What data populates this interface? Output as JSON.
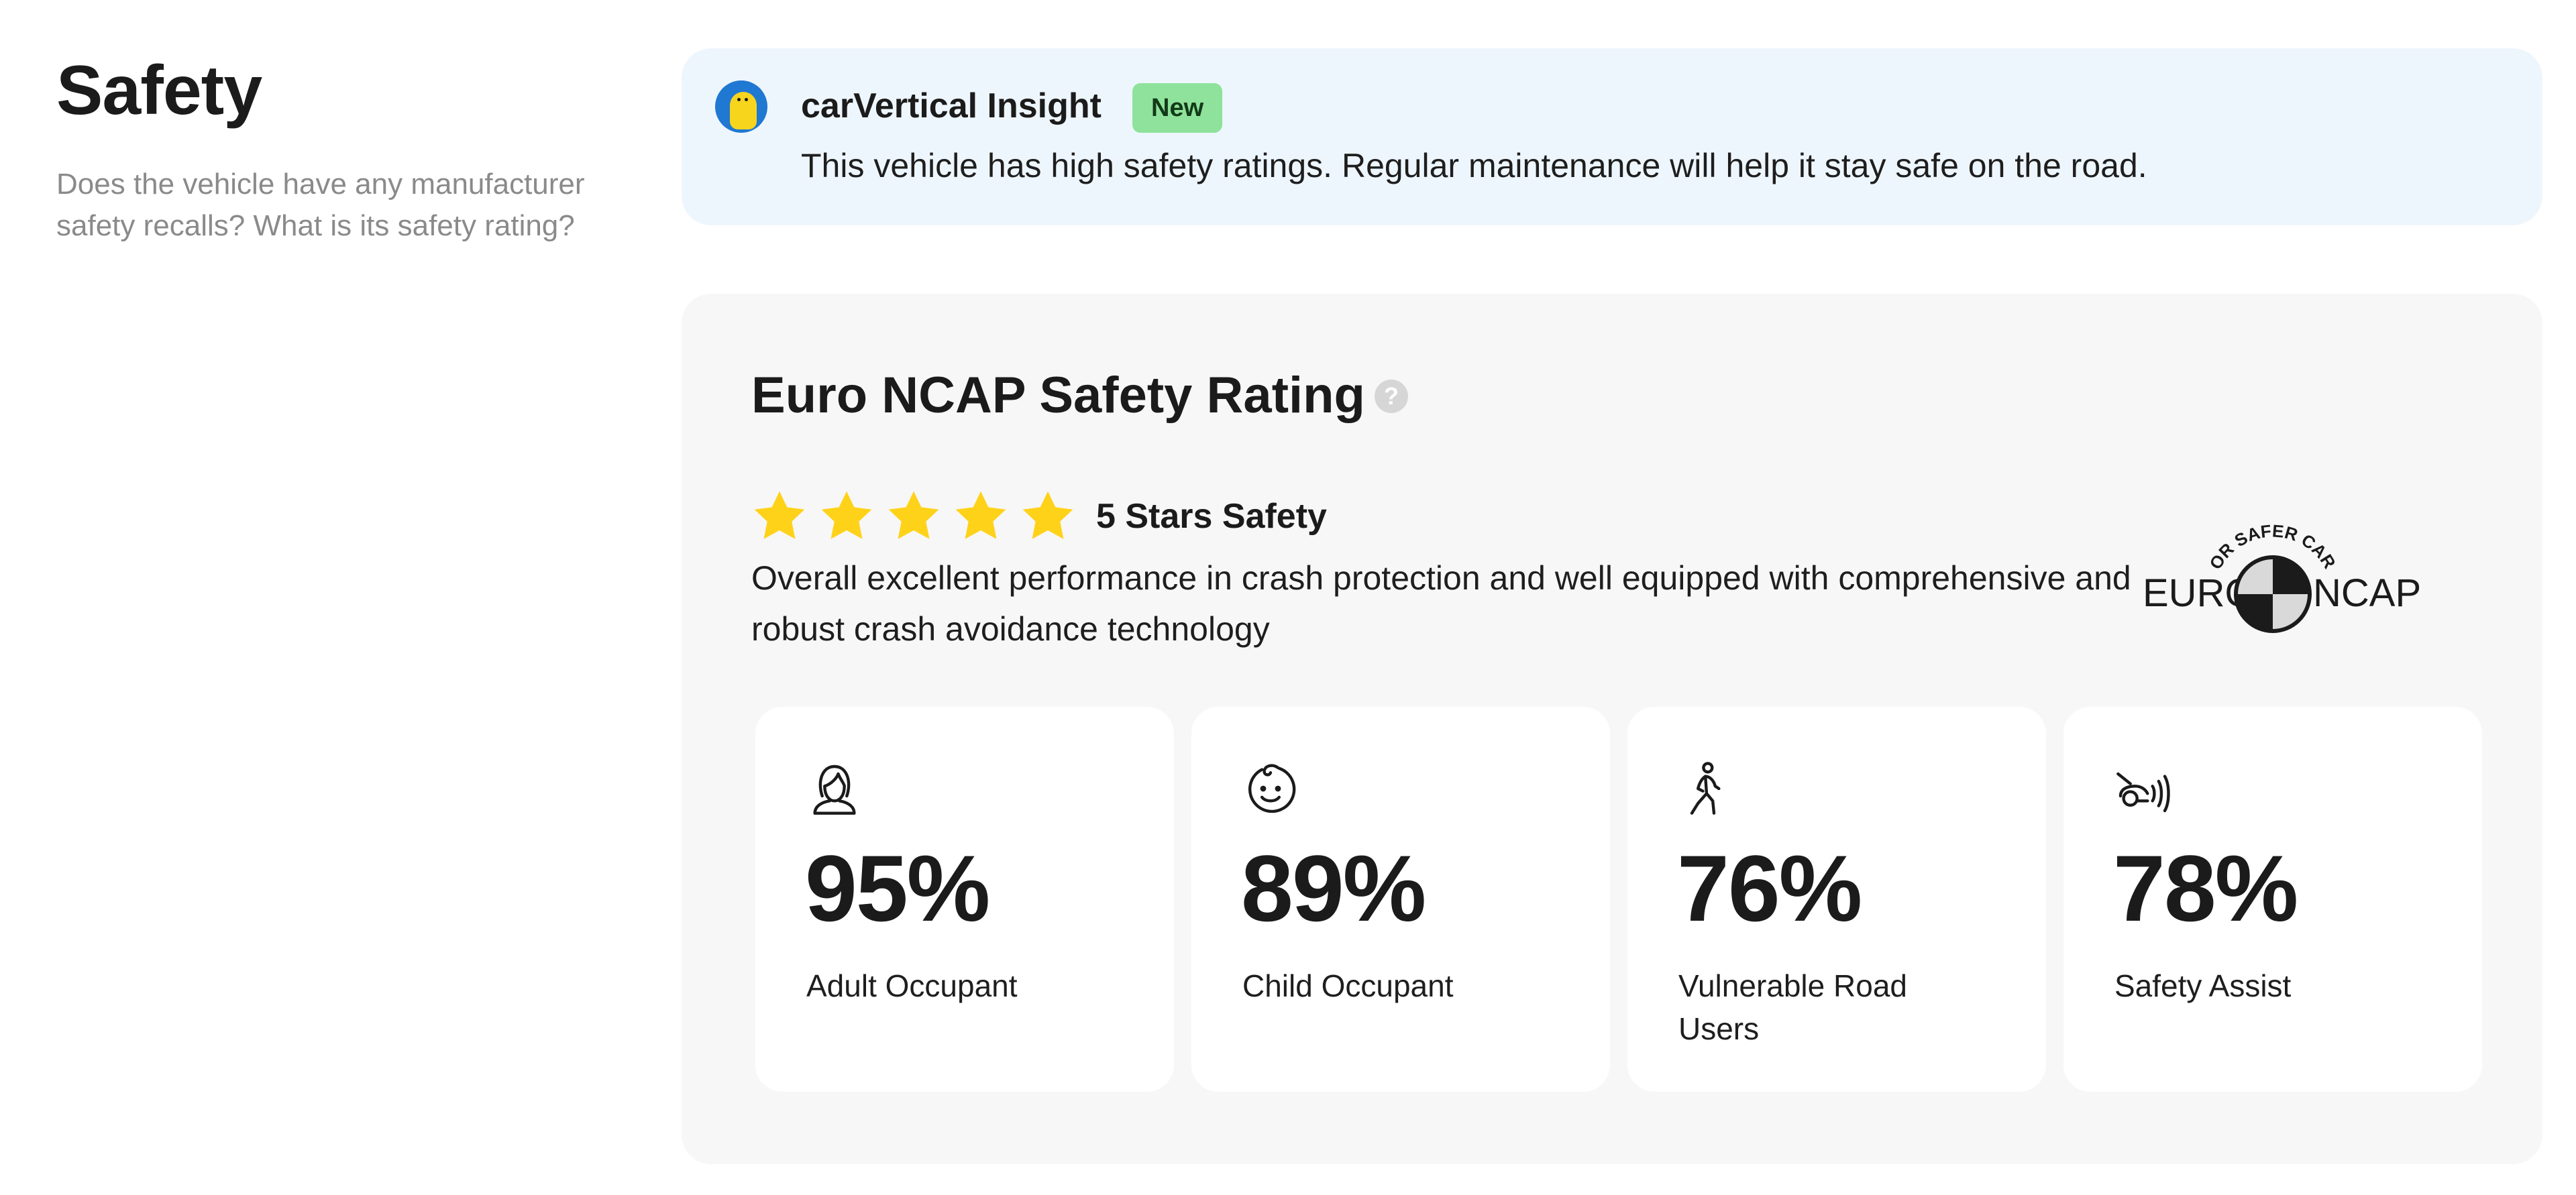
{
  "section": {
    "title": "Safety",
    "description": "Does the vehicle have any manufacturer safety recalls? What is its safety rating?"
  },
  "insight": {
    "title": "carVertical Insight",
    "badge": "New",
    "message": "This vehicle has high safety ratings. Regular maintenance will help it stay safe on the road.",
    "icon": "mascot-avatar-icon"
  },
  "rating": {
    "title": "Euro NCAP Safety Rating",
    "help_glyph": "?",
    "stars": 5,
    "stars_max": 5,
    "stars_label": "5 Stars Safety",
    "description": "Overall excellent performance in crash protection and well equipped with comprehensive and robust crash avoidance technology",
    "logo": {
      "top_text": "FOR SAFER CARS",
      "left_text": "EURO",
      "right_text": "NCAP"
    },
    "metrics": [
      {
        "value": "95%",
        "label": "Adult Occupant",
        "icon": "adult-occupant-icon"
      },
      {
        "value": "89%",
        "label": "Child Occupant",
        "icon": "child-occupant-icon"
      },
      {
        "value": "76%",
        "label": "Vulnerable Road Users",
        "icon": "pedestrian-icon"
      },
      {
        "value": "78%",
        "label": "Safety Assist",
        "icon": "safety-assist-icon"
      }
    ]
  },
  "colors": {
    "star": "#FFD21A",
    "insight_bg": "#EEF6FD",
    "badge_bg": "#8FE29B",
    "card_bg": "#F7F7F7",
    "avatar_blue": "#1F78D1"
  }
}
